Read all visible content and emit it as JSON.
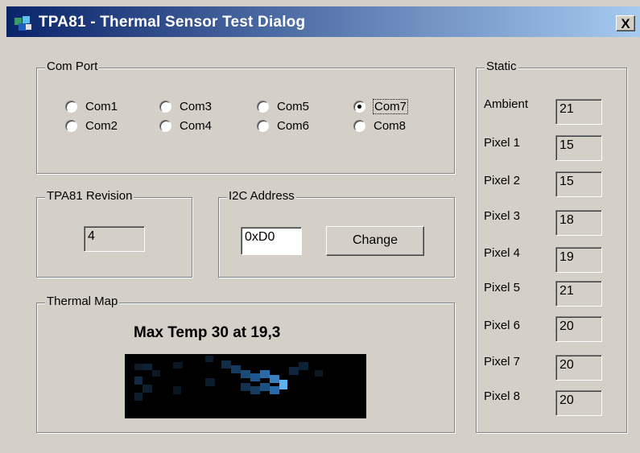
{
  "window": {
    "title": "TPA81 - Thermal Sensor Test Dialog",
    "close_glyph": "X",
    "title_bar_color": "#0a246a",
    "face_color": "#d4d0c8"
  },
  "com_port": {
    "legend": "Com Port",
    "options": [
      "Com1",
      "Com3",
      "Com5",
      "Com7",
      "Com2",
      "Com4",
      "Com6",
      "Com8"
    ],
    "selected": "Com7"
  },
  "revision": {
    "legend": "TPA81 Revision",
    "value": "4"
  },
  "i2c": {
    "legend": "I2C Address",
    "value": "0xD0",
    "button_label": "Change"
  },
  "thermal_map": {
    "legend": "Thermal Map",
    "heading": "Max Temp 30 at 19,3",
    "icons": {
      "map": "thermal-image-icon"
    }
  },
  "static": {
    "legend": "Static",
    "rows": [
      {
        "label": "Ambient",
        "value": "21"
      },
      {
        "label": "Pixel 1",
        "value": "15"
      },
      {
        "label": "Pixel 2",
        "value": "15"
      },
      {
        "label": "Pixel 3",
        "value": "18"
      },
      {
        "label": "Pixel 4",
        "value": "19"
      },
      {
        "label": "Pixel 5",
        "value": "21"
      },
      {
        "label": "Pixel 6",
        "value": "20"
      },
      {
        "label": "Pixel 7",
        "value": "20"
      },
      {
        "label": "Pixel 8",
        "value": "20"
      }
    ]
  }
}
